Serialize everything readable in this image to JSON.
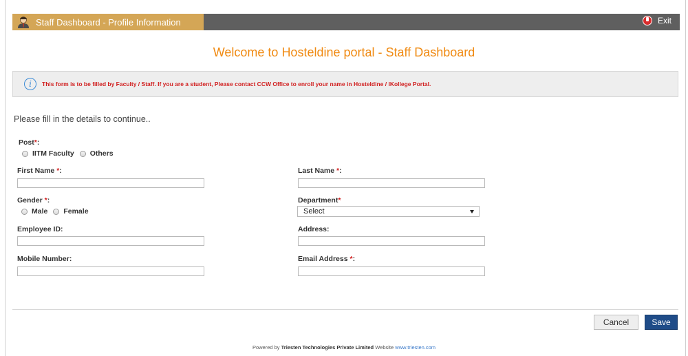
{
  "titlebar": {
    "title": "Staff Dashboard - Profile Information",
    "avatar_icon": "user-avatar-icon",
    "exit_label": "Exit",
    "exit_icon": "power-icon"
  },
  "welcome": "Welcome to Hosteldine portal - Staff Dashboard",
  "notice": {
    "icon": "info-icon",
    "text": "This form is to be filled by Faculty / Staff. If you are a student, Please contact CCW Office to enroll your name in Hosteldine / IKollege Portal."
  },
  "intro": "Please fill in the details to continue..",
  "form": {
    "post": {
      "label": "Post",
      "options": [
        "IITM Faculty",
        "Others"
      ]
    },
    "first_name": {
      "label": "First Name",
      "value": ""
    },
    "last_name": {
      "label": "Last Name",
      "value": ""
    },
    "gender": {
      "label": "Gender",
      "options": [
        "Male",
        "Female"
      ]
    },
    "department": {
      "label": "Department",
      "selected": "Select"
    },
    "employee_id": {
      "label": "Employee ID:",
      "value": ""
    },
    "address": {
      "label": "Address:",
      "value": ""
    },
    "mobile": {
      "label": "Mobile Number:",
      "value": ""
    },
    "email": {
      "label": "Email Address",
      "value": ""
    }
  },
  "buttons": {
    "cancel": "Cancel",
    "save": "Save"
  },
  "footer": {
    "prefix": "Powered by",
    "company": "Triesten Technologies Private Limited",
    "website_label": "Website",
    "website_url": "www.triesten.com"
  },
  "colors": {
    "accent_orange": "#f08a12",
    "titlebar": "#5f5f5f",
    "badge": "#d4a656",
    "save_button": "#1f4c88",
    "required": "#d11f1f"
  }
}
